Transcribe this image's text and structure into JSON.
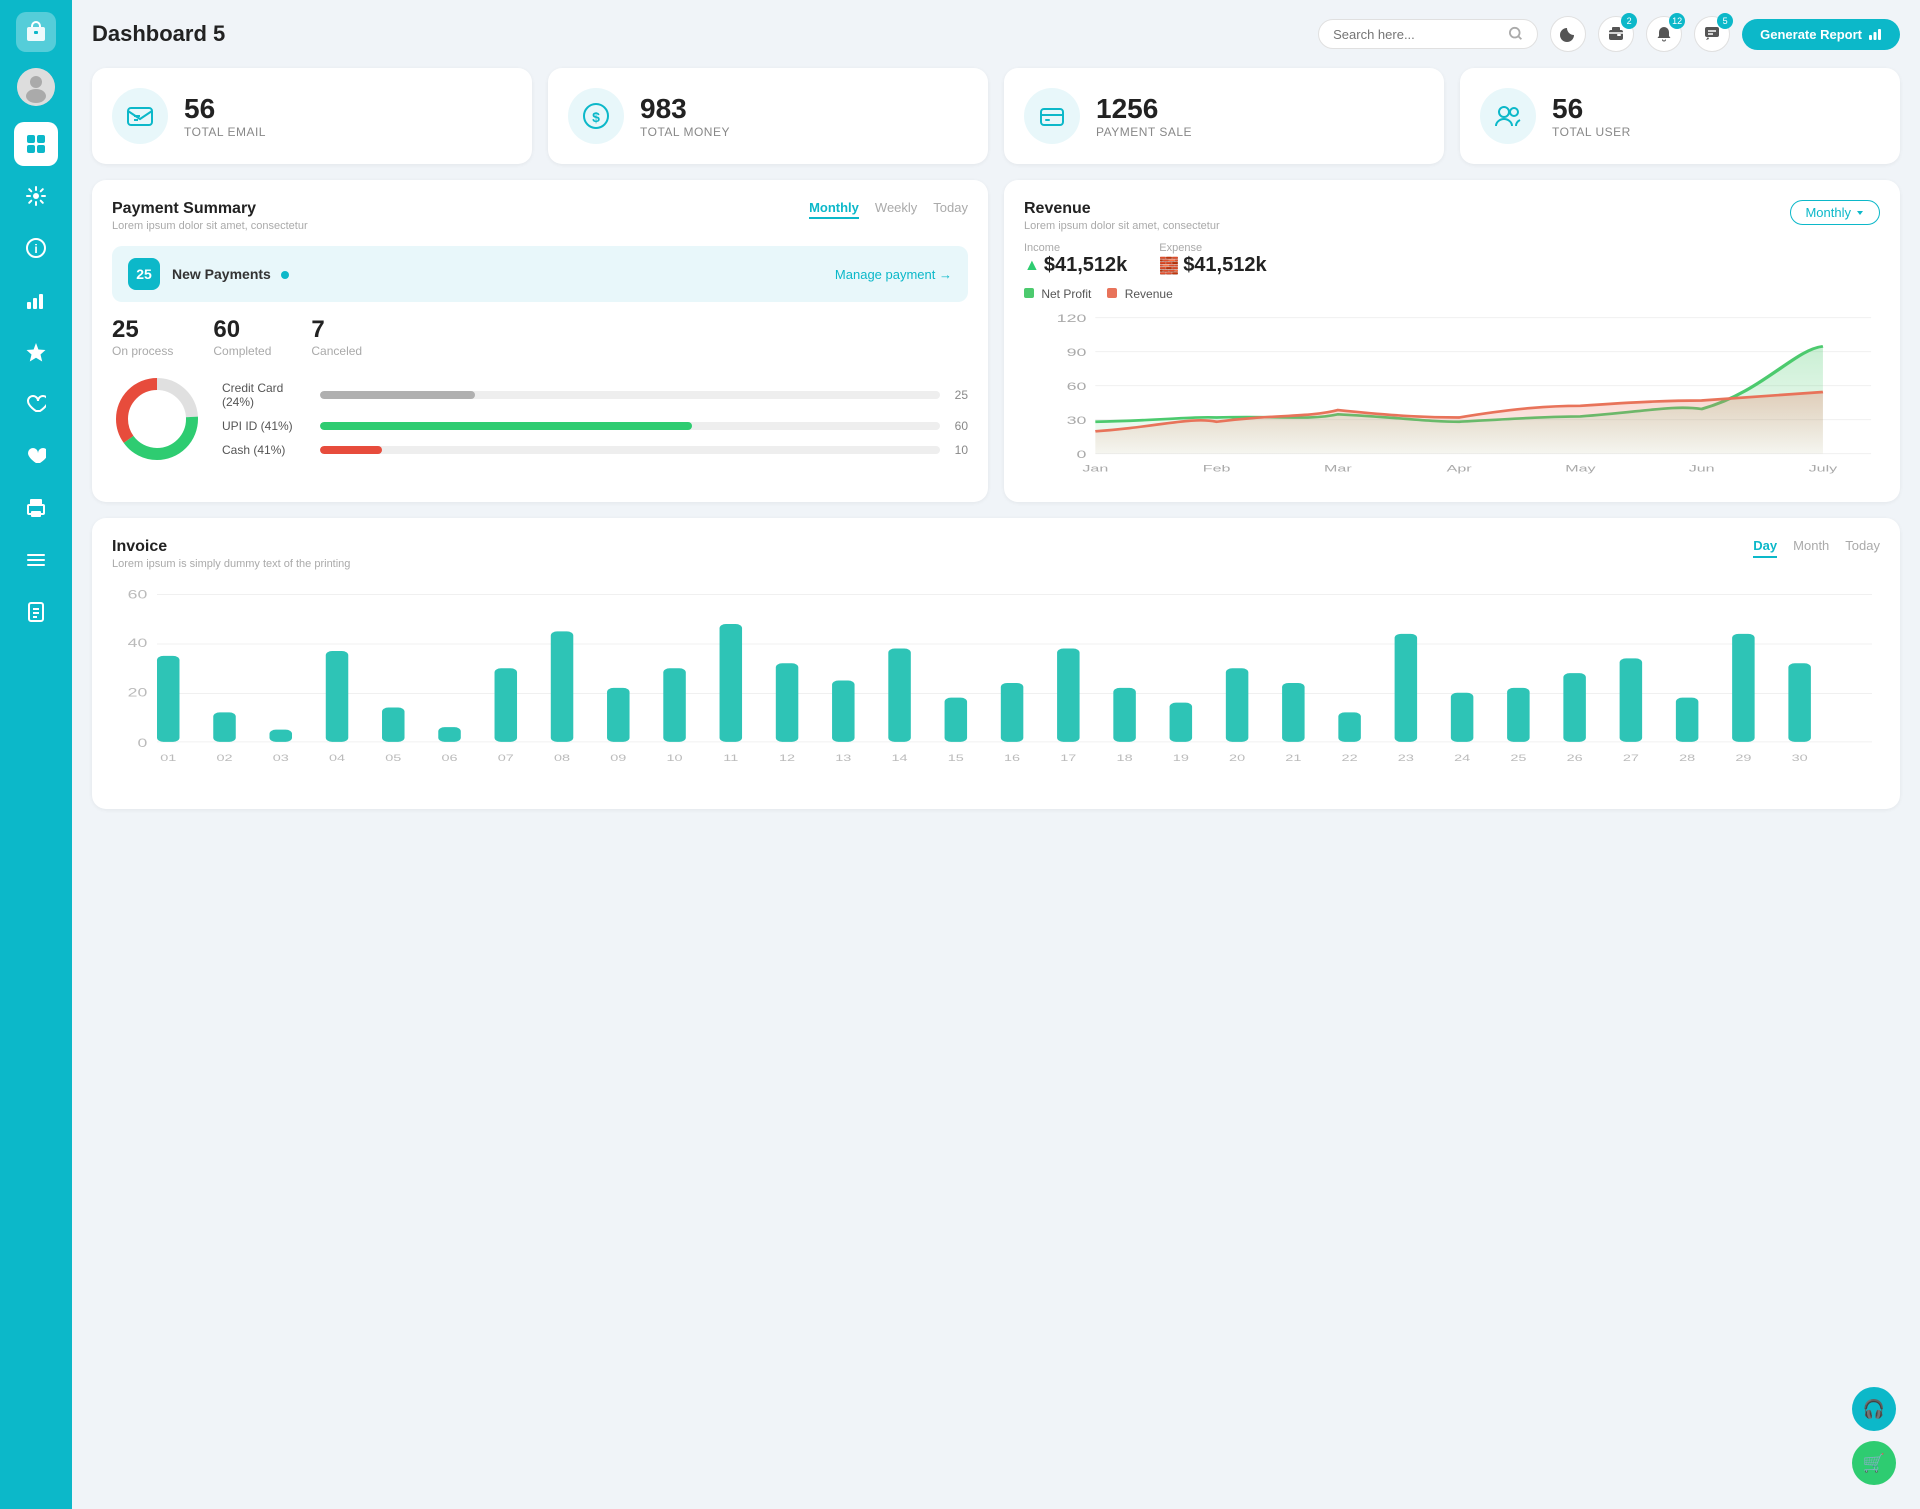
{
  "sidebar": {
    "logo_icon": "💼",
    "items": [
      {
        "id": "dashboard",
        "icon": "⊞",
        "active": true
      },
      {
        "id": "settings",
        "icon": "⚙"
      },
      {
        "id": "info",
        "icon": "ℹ"
      },
      {
        "id": "chart",
        "icon": "📊"
      },
      {
        "id": "star",
        "icon": "★"
      },
      {
        "id": "heart-outline",
        "icon": "♡"
      },
      {
        "id": "heart-filled",
        "icon": "♥"
      },
      {
        "id": "print",
        "icon": "🖨"
      },
      {
        "id": "list",
        "icon": "☰"
      },
      {
        "id": "document",
        "icon": "📋"
      }
    ]
  },
  "header": {
    "title": "Dashboard 5",
    "search_placeholder": "Search here...",
    "badge_wallet": "2",
    "badge_bell": "12",
    "badge_chat": "5",
    "generate_btn": "Generate Report"
  },
  "stats": [
    {
      "id": "email",
      "number": "56",
      "label": "TOTAL EMAIL",
      "icon": "📋"
    },
    {
      "id": "money",
      "number": "983",
      "label": "TOTAL MONEY",
      "icon": "$"
    },
    {
      "id": "payment",
      "number": "1256",
      "label": "PAYMENT SALE",
      "icon": "💳"
    },
    {
      "id": "user",
      "number": "56",
      "label": "TOTAL USER",
      "icon": "👥"
    }
  ],
  "payment_summary": {
    "title": "Payment Summary",
    "subtitle": "Lorem ipsum dolor sit amet, consectetur",
    "tabs": [
      "Monthly",
      "Weekly",
      "Today"
    ],
    "active_tab": "Monthly",
    "new_payments_count": "25",
    "new_payments_label": "New Payments",
    "manage_link": "Manage payment →",
    "on_process": "25",
    "on_process_label": "On process",
    "completed": "60",
    "completed_label": "Completed",
    "canceled": "7",
    "canceled_label": "Canceled",
    "bars": [
      {
        "label": "Credit Card (24%)",
        "value": 25,
        "max": 100,
        "color": "#b0b0b0",
        "display": "25"
      },
      {
        "label": "UPI ID (41%)",
        "value": 60,
        "max": 100,
        "color": "#2ecc71",
        "display": "60"
      },
      {
        "label": "Cash (41%)",
        "value": 10,
        "max": 100,
        "color": "#e74c3c",
        "display": "10"
      }
    ],
    "donut": {
      "segments": [
        {
          "color": "#e0e0e0",
          "pct": 24
        },
        {
          "color": "#2ecc71",
          "pct": 41
        },
        {
          "color": "#e74c3c",
          "pct": 35
        }
      ]
    }
  },
  "revenue": {
    "title": "Revenue",
    "subtitle": "Lorem ipsum dolor sit amet, consectetur",
    "monthly_btn": "Monthly",
    "income_label": "Income",
    "income_value": "$41,512k",
    "expense_label": "Expense",
    "expense_value": "$41,512k",
    "legend": [
      {
        "label": "Net Profit",
        "color": "#4cca6e"
      },
      {
        "label": "Revenue",
        "color": "#e8735a"
      }
    ],
    "x_labels": [
      "Jan",
      "Feb",
      "Mar",
      "Apr",
      "May",
      "Jun",
      "July"
    ],
    "y_labels": [
      "0",
      "30",
      "60",
      "90",
      "120"
    ],
    "net_profit_data": [
      28,
      30,
      35,
      28,
      32,
      38,
      95
    ],
    "revenue_data": [
      20,
      28,
      38,
      32,
      42,
      48,
      55
    ]
  },
  "invoice": {
    "title": "Invoice",
    "subtitle": "Lorem ipsum is simply dummy text of the printing",
    "tabs": [
      "Day",
      "Month",
      "Today"
    ],
    "active_tab": "Day",
    "y_labels": [
      "0",
      "20",
      "40",
      "60"
    ],
    "x_labels": [
      "01",
      "02",
      "03",
      "04",
      "05",
      "06",
      "07",
      "08",
      "09",
      "10",
      "11",
      "12",
      "13",
      "14",
      "15",
      "16",
      "17",
      "18",
      "19",
      "20",
      "21",
      "22",
      "23",
      "24",
      "25",
      "26",
      "27",
      "28",
      "29",
      "30"
    ],
    "bar_data": [
      35,
      12,
      5,
      37,
      14,
      6,
      30,
      45,
      22,
      30,
      48,
      32,
      25,
      38,
      18,
      24,
      38,
      22,
      16,
      30,
      24,
      12,
      44,
      20,
      22,
      28,
      34,
      18,
      44,
      32
    ]
  },
  "float_buttons": [
    {
      "id": "support",
      "icon": "🎧",
      "color": "#0cb8c9"
    },
    {
      "id": "cart",
      "icon": "🛒",
      "color": "#2ecc71"
    }
  ]
}
